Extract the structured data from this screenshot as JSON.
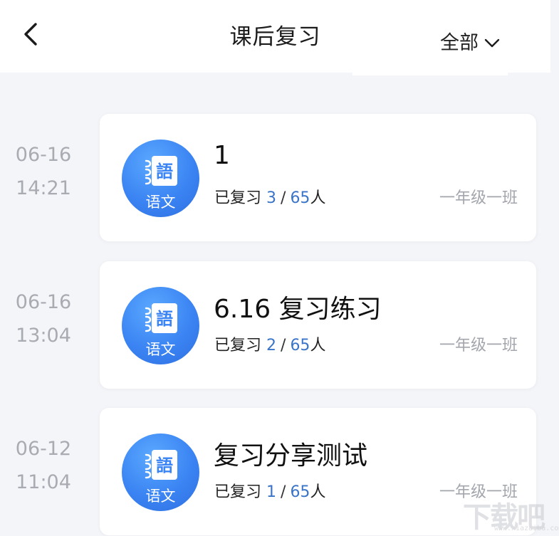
{
  "header": {
    "title": "课后复习",
    "filter_label": "全部"
  },
  "icons": {
    "back": "chevron-left-icon",
    "filter": "chevron-down-icon",
    "subject": "chinese-book-icon"
  },
  "colors": {
    "accent": "#3a74c8",
    "icon_blue": "#3b84f3",
    "muted": "#a9abb2",
    "background": "#f4f5f8"
  },
  "items": [
    {
      "date": "06-16",
      "time": "14:21",
      "subject": "语文",
      "title": "1",
      "reviewed_label": "已复习",
      "reviewed": "3",
      "total": "65",
      "unit": "人",
      "class_name": "一年级一班"
    },
    {
      "date": "06-16",
      "time": "13:04",
      "subject": "语文",
      "title": "6.16 复习练习",
      "reviewed_label": "已复习",
      "reviewed": "2",
      "total": "65",
      "unit": "人",
      "class_name": "一年级一班"
    },
    {
      "date": "06-12",
      "time": "11:04",
      "subject": "语文",
      "title": "复习分享测试",
      "reviewed_label": "已复习",
      "reviewed": "1",
      "total": "65",
      "unit": "人",
      "class_name": "一年级一班"
    }
  ],
  "watermark": {
    "text": "下载吧",
    "url": "www.xiazaiba.com"
  }
}
